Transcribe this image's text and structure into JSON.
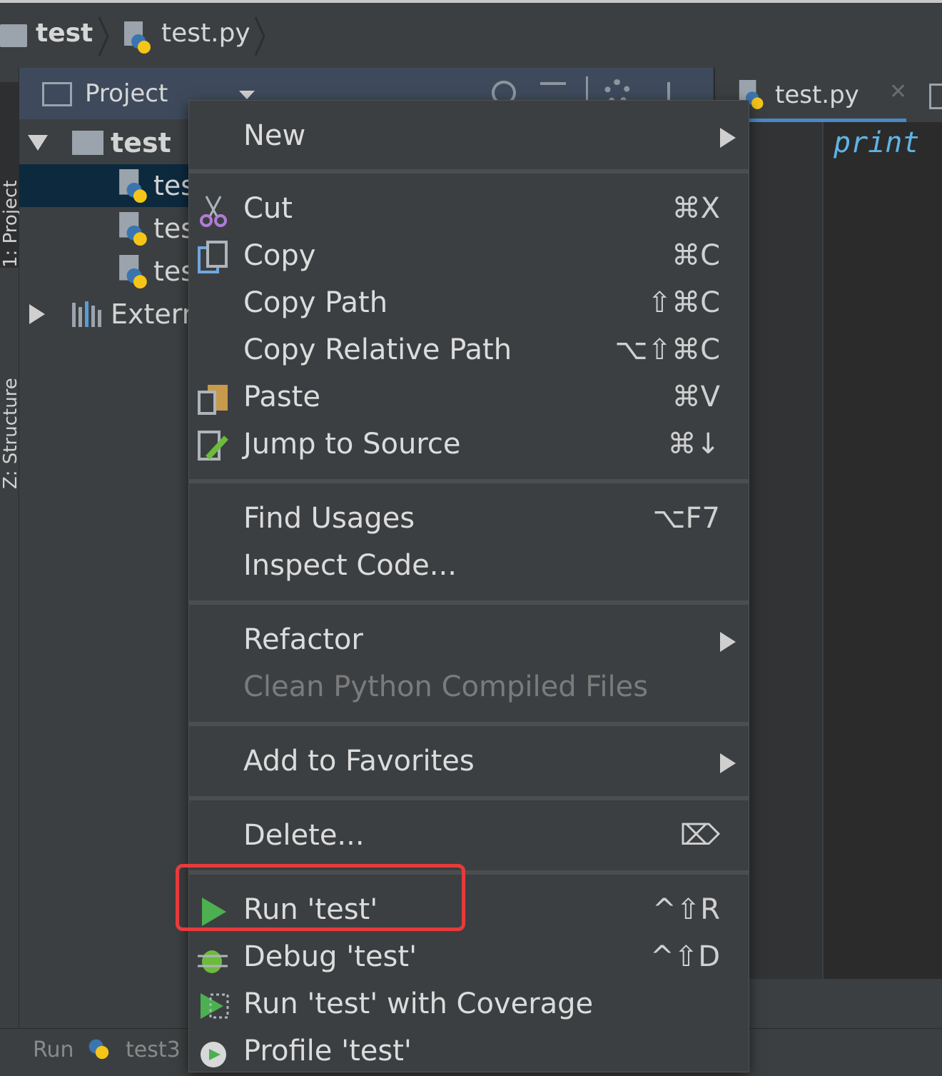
{
  "breadcrumb": {
    "folder": "test",
    "file": "test.py"
  },
  "toolwindows": {
    "project_tab": "1: Project",
    "structure_tab": "Z: Structure"
  },
  "project_panel": {
    "title": "Project",
    "tree": [
      {
        "label": "test",
        "kind": "folder"
      },
      {
        "label": "tes",
        "kind": "python-file"
      },
      {
        "label": "tes",
        "kind": "python-file"
      },
      {
        "label": "tes",
        "kind": "python-file"
      },
      {
        "label": "Extern",
        "kind": "library"
      }
    ]
  },
  "editor": {
    "tab_label": "test.py",
    "code_snippet": "print"
  },
  "bottom_bar": {
    "run_label": "Run",
    "run_config": "test3"
  },
  "context_menu": {
    "items": [
      {
        "label": "New",
        "shortcut": "",
        "submenu": true
      },
      {
        "label": "Cut",
        "shortcut": "⌘X"
      },
      {
        "label": "Copy",
        "shortcut": "⌘C"
      },
      {
        "label": "Copy Path",
        "shortcut": "⇧⌘C"
      },
      {
        "label": "Copy Relative Path",
        "shortcut": "⌥⇧⌘C"
      },
      {
        "label": "Paste",
        "shortcut": "⌘V"
      },
      {
        "label": "Jump to Source",
        "shortcut": "⌘↓"
      },
      {
        "label": "Find Usages",
        "shortcut": "⌥F7"
      },
      {
        "label": "Inspect Code...",
        "shortcut": ""
      },
      {
        "label": "Refactor",
        "shortcut": "",
        "submenu": true
      },
      {
        "label": "Clean Python Compiled Files",
        "shortcut": "",
        "disabled": true
      },
      {
        "label": "Add to Favorites",
        "shortcut": "",
        "submenu": true
      },
      {
        "label": "Delete...",
        "shortcut": "⌦"
      },
      {
        "label": "Run 'test'",
        "shortcut": "^⇧R"
      },
      {
        "label": "Debug 'test'",
        "shortcut": "^⇧D"
      },
      {
        "label": "Run 'test' with Coverage",
        "shortcut": ""
      },
      {
        "label": "Profile 'test'",
        "shortcut": ""
      }
    ]
  },
  "colors": {
    "highlight_border": "#e63b3b",
    "run_green": "#4caf50",
    "selection": "#0d293e"
  }
}
